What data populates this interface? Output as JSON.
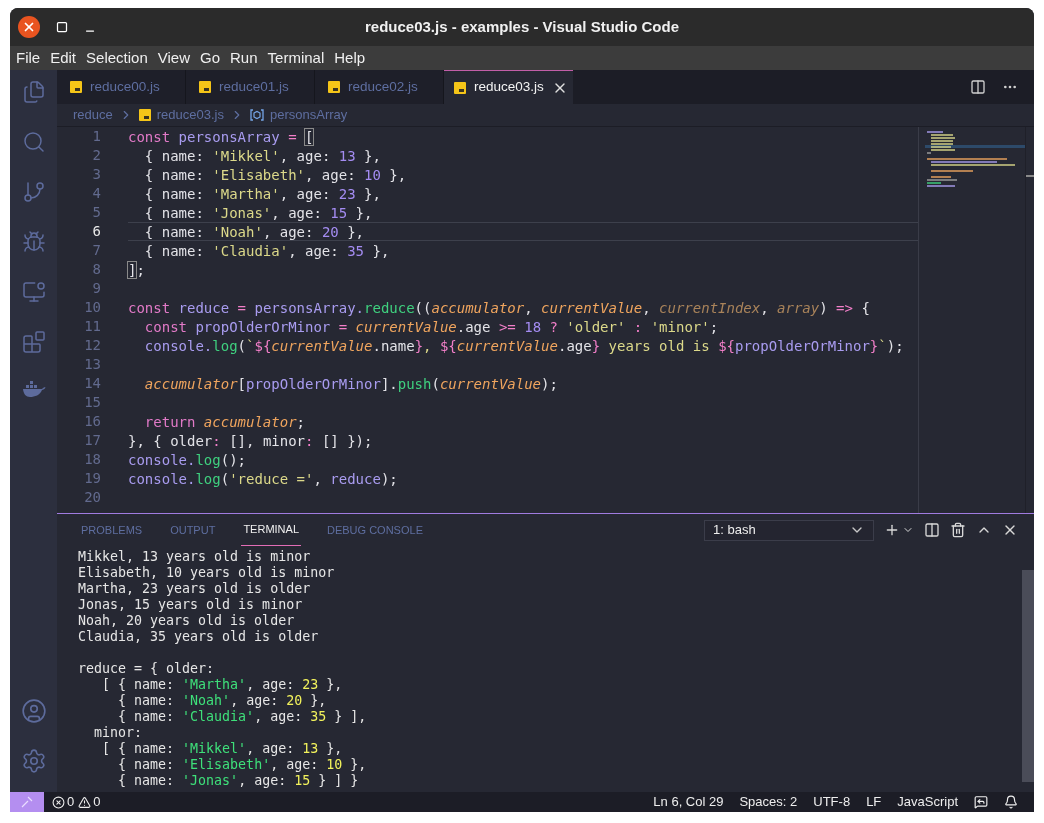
{
  "window": {
    "title": "reduce03.js - examples - Visual Studio Code"
  },
  "menu": [
    "File",
    "Edit",
    "Selection",
    "View",
    "Go",
    "Run",
    "Terminal",
    "Help"
  ],
  "tabs": [
    {
      "label": "reduce00.js",
      "selected": false
    },
    {
      "label": "reduce01.js",
      "selected": false
    },
    {
      "label": "reduce02.js",
      "selected": false
    },
    {
      "label": "reduce03.js",
      "selected": true
    }
  ],
  "breadcrumb": {
    "folder": "reduce",
    "file": "reduce03.js",
    "symbol": "personsArray"
  },
  "editor": {
    "lines": [
      {
        "number": "1",
        "current": false,
        "tokens": [
          {
            "kind": "kw",
            "text": "const "
          },
          {
            "kind": "var",
            "text": "personsArray"
          },
          {
            "kind": "op",
            "text": " = "
          },
          {
            "kind": "match",
            "text": "["
          }
        ]
      },
      {
        "number": "2",
        "current": false,
        "tokens": [
          {
            "kind": "p",
            "text": "  { name: "
          },
          {
            "kind": "str",
            "text": "'Mikkel'"
          },
          {
            "kind": "p",
            "text": ", age: "
          },
          {
            "kind": "num",
            "text": "13"
          },
          {
            "kind": "p",
            "text": " },"
          }
        ]
      },
      {
        "number": "3",
        "current": false,
        "tokens": [
          {
            "kind": "p",
            "text": "  { name: "
          },
          {
            "kind": "str",
            "text": "'Elisabeth'"
          },
          {
            "kind": "p",
            "text": ", age: "
          },
          {
            "kind": "num",
            "text": "10"
          },
          {
            "kind": "p",
            "text": " },"
          }
        ]
      },
      {
        "number": "4",
        "current": false,
        "tokens": [
          {
            "kind": "p",
            "text": "  { name: "
          },
          {
            "kind": "str",
            "text": "'Martha'"
          },
          {
            "kind": "p",
            "text": ", age: "
          },
          {
            "kind": "num",
            "text": "23"
          },
          {
            "kind": "p",
            "text": " },"
          }
        ]
      },
      {
        "number": "5",
        "current": false,
        "tokens": [
          {
            "kind": "p",
            "text": "  { name: "
          },
          {
            "kind": "str",
            "text": "'Jonas'"
          },
          {
            "kind": "p",
            "text": ", age: "
          },
          {
            "kind": "num",
            "text": "15"
          },
          {
            "kind": "p",
            "text": " },"
          }
        ]
      },
      {
        "number": "6",
        "current": true,
        "tokens": [
          {
            "kind": "p",
            "text": "  { name: "
          },
          {
            "kind": "str",
            "text": "'Noah'"
          },
          {
            "kind": "p",
            "text": ", age: "
          },
          {
            "kind": "num",
            "text": "20"
          },
          {
            "kind": "p",
            "text": " },"
          }
        ]
      },
      {
        "number": "7",
        "current": false,
        "tokens": [
          {
            "kind": "p",
            "text": "  { name: "
          },
          {
            "kind": "str",
            "text": "'Claudia'"
          },
          {
            "kind": "p",
            "text": ", age: "
          },
          {
            "kind": "num",
            "text": "35"
          },
          {
            "kind": "p",
            "text": " },"
          }
        ]
      },
      {
        "number": "8",
        "current": false,
        "tokens": [
          {
            "kind": "match",
            "text": "]"
          },
          {
            "kind": "p",
            "text": ";"
          }
        ]
      },
      {
        "number": "9",
        "current": false
      },
      {
        "number": "10",
        "current": false,
        "tokens": [
          {
            "kind": "kw",
            "text": "const "
          },
          {
            "kind": "var",
            "text": "reduce"
          },
          {
            "kind": "op",
            "text": " = "
          },
          {
            "kind": "var",
            "text": "personsArray."
          },
          {
            "kind": "fn",
            "text": "reduce"
          },
          {
            "kind": "p",
            "text": "(("
          },
          {
            "kind": "prm",
            "text": "accumulator"
          },
          {
            "kind": "p",
            "text": ", "
          },
          {
            "kind": "prm",
            "text": "currentValue"
          },
          {
            "kind": "p",
            "text": ", "
          },
          {
            "kind": "unused",
            "text": "currentIndex"
          },
          {
            "kind": "p",
            "text": ", "
          },
          {
            "kind": "unused",
            "text": "array"
          },
          {
            "kind": "p",
            "text": ") "
          },
          {
            "kind": "op",
            "text": "=>"
          },
          {
            "kind": "p",
            "text": " {"
          }
        ]
      },
      {
        "number": "11",
        "current": false,
        "tokens": [
          {
            "kind": "kw",
            "text": "  const "
          },
          {
            "kind": "var",
            "text": "propOlderOrMinor"
          },
          {
            "kind": "op",
            "text": " = "
          },
          {
            "kind": "prm",
            "text": "currentValue"
          },
          {
            "kind": "p",
            "text": ".age "
          },
          {
            "kind": "op",
            "text": ">= "
          },
          {
            "kind": "num",
            "text": "18"
          },
          {
            "kind": "op",
            "text": " ? "
          },
          {
            "kind": "str",
            "text": "'older'"
          },
          {
            "kind": "op",
            "text": " : "
          },
          {
            "kind": "str",
            "text": "'minor'"
          },
          {
            "kind": "p",
            "text": ";"
          }
        ]
      },
      {
        "number": "12",
        "current": false,
        "tokens": [
          {
            "kind": "var",
            "text": "  console."
          },
          {
            "kind": "fn",
            "text": "log"
          },
          {
            "kind": "p",
            "text": "("
          },
          {
            "kind": "str",
            "text": "`"
          },
          {
            "kind": "op",
            "text": "${"
          },
          {
            "kind": "prm",
            "text": "currentValue"
          },
          {
            "kind": "p",
            "text": ".name"
          },
          {
            "kind": "op",
            "text": "}"
          },
          {
            "kind": "str",
            "text": ", "
          },
          {
            "kind": "op",
            "text": "${"
          },
          {
            "kind": "prm",
            "text": "currentValue"
          },
          {
            "kind": "p",
            "text": ".age"
          },
          {
            "kind": "op",
            "text": "}"
          },
          {
            "kind": "str",
            "text": " years old is "
          },
          {
            "kind": "op",
            "text": "${"
          },
          {
            "kind": "var",
            "text": "propOlderOrMinor"
          },
          {
            "kind": "op",
            "text": "}"
          },
          {
            "kind": "str",
            "text": "`"
          },
          {
            "kind": "p",
            "text": ");"
          }
        ]
      },
      {
        "number": "13",
        "current": false
      },
      {
        "number": "14",
        "current": false,
        "tokens": [
          {
            "kind": "prm",
            "text": "  accumulator"
          },
          {
            "kind": "p",
            "text": "["
          },
          {
            "kind": "var",
            "text": "propOlderOrMinor"
          },
          {
            "kind": "p",
            "text": "]."
          },
          {
            "kind": "fn",
            "text": "push"
          },
          {
            "kind": "p",
            "text": "("
          },
          {
            "kind": "prm",
            "text": "currentValue"
          },
          {
            "kind": "p",
            "text": ");"
          }
        ]
      },
      {
        "number": "15",
        "current": false
      },
      {
        "number": "16",
        "current": false,
        "tokens": [
          {
            "kind": "kw",
            "text": "  return "
          },
          {
            "kind": "prm",
            "text": "accumulator"
          },
          {
            "kind": "p",
            "text": ";"
          }
        ]
      },
      {
        "number": "17",
        "current": false,
        "tokens": [
          {
            "kind": "p",
            "text": "}, { older"
          },
          {
            "kind": "op",
            "text": ":"
          },
          {
            "kind": "p",
            "text": " [], minor"
          },
          {
            "kind": "op",
            "text": ":"
          },
          {
            "kind": "p",
            "text": " [] });"
          }
        ]
      },
      {
        "number": "18",
        "current": false,
        "tokens": [
          {
            "kind": "var",
            "text": "console."
          },
          {
            "kind": "fn",
            "text": "log"
          },
          {
            "kind": "p",
            "text": "();"
          }
        ]
      },
      {
        "number": "19",
        "current": false,
        "tokens": [
          {
            "kind": "var",
            "text": "console."
          },
          {
            "kind": "fn",
            "text": "log"
          },
          {
            "kind": "p",
            "text": "("
          },
          {
            "kind": "str",
            "text": "'reduce ='"
          },
          {
            "kind": "p",
            "text": ", "
          },
          {
            "kind": "var",
            "text": "reduce"
          },
          {
            "kind": "p",
            "text": ");"
          }
        ]
      },
      {
        "number": "20",
        "current": false
      }
    ]
  },
  "panel": {
    "tabs": [
      {
        "label": "PROBLEMS",
        "selected": false
      },
      {
        "label": "OUTPUT",
        "selected": false
      },
      {
        "label": "TERMINAL",
        "selected": true
      },
      {
        "label": "DEBUG CONSOLE",
        "selected": false
      }
    ],
    "terminal_select": "1: bash",
    "blocks": [
      {
        "lines": [
          {
            "tokens": [
              {
                "kind": "p",
                "text": "Mikkel, 13 years old is minor"
              }
            ]
          },
          {
            "tokens": [
              {
                "kind": "p",
                "text": "Elisabeth, 10 years old is minor"
              }
            ]
          },
          {
            "tokens": [
              {
                "kind": "p",
                "text": "Martha, 23 years old is older"
              }
            ]
          },
          {
            "tokens": [
              {
                "kind": "p",
                "text": "Jonas, 15 years old is minor"
              }
            ]
          },
          {
            "tokens": [
              {
                "kind": "p",
                "text": "Noah, 20 years old is older"
              }
            ]
          },
          {
            "tokens": [
              {
                "kind": "p",
                "text": "Claudia, 35 years old is older"
              }
            ]
          }
        ]
      },
      {
        "lines": [
          {
            "tokens": [
              {
                "kind": "p",
                "text": "reduce = { older:"
              }
            ]
          },
          {
            "tokens": [
              {
                "kind": "p",
                "text": "   [ { name: "
              },
              {
                "kind": "str",
                "text": "'Martha'"
              },
              {
                "kind": "p",
                "text": ", age: "
              },
              {
                "kind": "num",
                "text": "23"
              },
              {
                "kind": "p",
                "text": " },"
              }
            ]
          },
          {
            "tokens": [
              {
                "kind": "p",
                "text": "     { name: "
              },
              {
                "kind": "str",
                "text": "'Noah'"
              },
              {
                "kind": "p",
                "text": ", age: "
              },
              {
                "kind": "num",
                "text": "20"
              },
              {
                "kind": "p",
                "text": " },"
              }
            ]
          },
          {
            "tokens": [
              {
                "kind": "p",
                "text": "     { name: "
              },
              {
                "kind": "str",
                "text": "'Claudia'"
              },
              {
                "kind": "p",
                "text": ", age: "
              },
              {
                "kind": "num",
                "text": "35"
              },
              {
                "kind": "p",
                "text": " } ],"
              }
            ]
          },
          {
            "tokens": [
              {
                "kind": "p",
                "text": "  minor:"
              }
            ]
          },
          {
            "tokens": [
              {
                "kind": "p",
                "text": "   [ { name: "
              },
              {
                "kind": "str",
                "text": "'Mikkel'"
              },
              {
                "kind": "p",
                "text": ", age: "
              },
              {
                "kind": "num",
                "text": "13"
              },
              {
                "kind": "p",
                "text": " },"
              }
            ]
          },
          {
            "tokens": [
              {
                "kind": "p",
                "text": "     { name: "
              },
              {
                "kind": "str",
                "text": "'Elisabeth'"
              },
              {
                "kind": "p",
                "text": ", age: "
              },
              {
                "kind": "num",
                "text": "10"
              },
              {
                "kind": "p",
                "text": " },"
              }
            ]
          },
          {
            "tokens": [
              {
                "kind": "p",
                "text": "     { name: "
              },
              {
                "kind": "str",
                "text": "'Jonas'"
              },
              {
                "kind": "p",
                "text": ", age: "
              },
              {
                "kind": "num",
                "text": "15"
              },
              {
                "kind": "p",
                "text": " } ] }"
              }
            ]
          }
        ]
      }
    ]
  },
  "status_bar": {
    "errors": "0",
    "warnings": "0",
    "items": [
      "Ln 6, Col 29",
      "Spaces: 2",
      "UTF-8",
      "LF",
      "JavaScript"
    ]
  }
}
